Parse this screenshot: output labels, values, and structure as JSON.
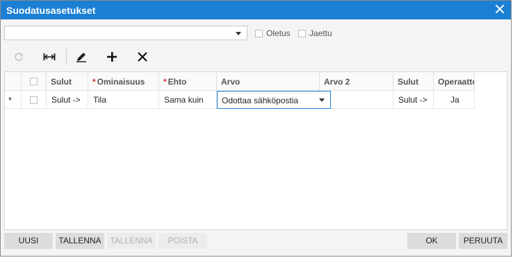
{
  "dialog": {
    "title": "Suodatusasetukset"
  },
  "filter": {
    "selected": "",
    "default_label": "Oletus",
    "shared_label": "Jaettu"
  },
  "toolbar": {
    "icons": [
      "refresh-icon",
      "fit-columns-icon",
      "edit-icon",
      "add-icon",
      "delete-icon"
    ]
  },
  "grid": {
    "columns": [
      "Sulut",
      "Ominaisuus",
      "Ehto",
      "Arvo",
      "Arvo 2",
      "Sulut",
      "Operaattori"
    ],
    "required": [
      "Ominaisuus",
      "Ehto"
    ],
    "row": {
      "marker": "*",
      "open_bracket": "Sulut ->",
      "property": "Tila",
      "condition": "Sama kuin",
      "value": "Odottaa sähköpostia",
      "value2": "",
      "close_bracket": "Sulut ->",
      "operator": "Ja"
    }
  },
  "buttons": {
    "new": "UUSI",
    "save": "TALLENNA",
    "save_as": "TALLENNA",
    "delete": "POISTA",
    "ok": "OK",
    "cancel": "PERUUTA"
  },
  "colors": {
    "titlebar": "#1b7fd3",
    "required": "#d9262d"
  }
}
